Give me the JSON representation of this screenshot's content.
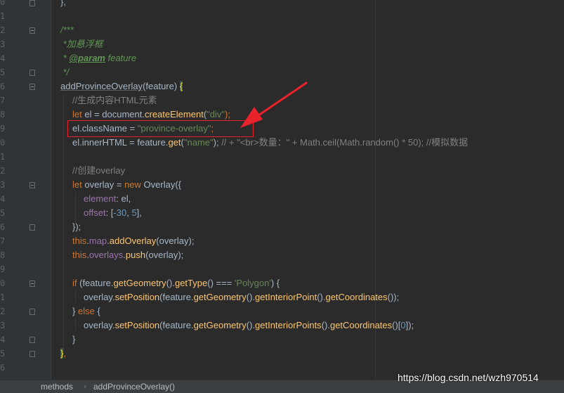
{
  "gutter": {
    "line_numbers": [
      "0",
      "1",
      "2",
      "3",
      "4",
      "5",
      "6",
      "7",
      "8",
      "9",
      "0",
      "1",
      "2",
      "3",
      "4",
      "5",
      "6",
      "7",
      "8",
      "9",
      "0",
      "1",
      "2",
      "3",
      "4",
      "5",
      "6"
    ]
  },
  "code": {
    "l0": "},",
    "l2": "/***",
    "l3": " *加悬浮框",
    "l4_star": " * ",
    "l4_tag": "@param",
    "l4_rest": " feature",
    "l5": " */",
    "l6_name": "addProvinceOverlay",
    "l6_args": "(feature) ",
    "l6_brace": "{",
    "l7": "//生成内容HTML元素",
    "l8_let": "let",
    "l8_a": " el = document.",
    "l8_fn": "createElement",
    "l8_b": "(",
    "l8_str": "\"div\"",
    "l8_c": ");",
    "l9_a": "el.className = ",
    "l9_str": "\"province-overlay\"",
    "l9_c": ";",
    "l10_a": "el.innerHTML = feature.",
    "l10_fn": "get",
    "l10_b": "(",
    "l10_str": "\"name\"",
    "l10_c": "); ",
    "l10_com": "// + \"<br>数量：\" + Math.ceil(Math.random() * 50); //模拟数据",
    "l12": "//创建overlay",
    "l13_let": "let",
    "l13_a": " overlay = ",
    "l13_new": "new",
    "l13_b": " Overlay({",
    "l14_prop": "element",
    "l14_a": ": el,",
    "l15_prop": "offset",
    "l15_a": ": [",
    "l15_n1": "-30",
    "l15_sep": ", ",
    "l15_n2": "5",
    "l15_b": "],",
    "l16": "});",
    "l17_this": "this",
    "l17_dot": ".",
    "l17_prop": "map",
    "l17_dot2": ".",
    "l17_fn": "addOverlay",
    "l17_b": "(overlay);",
    "l18_this": "this",
    "l18_dot": ".",
    "l18_prop": "overlays",
    "l18_dot2": ".",
    "l18_fn": "push",
    "l18_b": "(overlay);",
    "l20_if": "if",
    "l20_a": " (feature.",
    "l20_fn1": "getGeometry",
    "l20_b": "().",
    "l20_fn2": "getType",
    "l20_c": "() === ",
    "l20_str": "'Polygon'",
    "l20_d": ") {",
    "l21_a": "overlay.",
    "l21_fn1": "setPosition",
    "l21_b": "(feature.",
    "l21_fn2": "getGeometry",
    "l21_c": "().",
    "l21_fn3": "getInteriorPoint",
    "l21_d": "().",
    "l21_fn4": "getCoordinates",
    "l21_e": "());",
    "l22_a": "} ",
    "l22_else": "else",
    "l22_b": " {",
    "l23_a": "overlay.",
    "l23_fn1": "setPosition",
    "l23_b": "(feature.",
    "l23_fn2": "getGeometry",
    "l23_c": "().",
    "l23_fn3": "getInteriorPoints",
    "l23_d": "().",
    "l23_fn4": "getCoordinates",
    "l23_e": "()[",
    "l23_n": "0",
    "l23_f": "]);",
    "l24": "}",
    "l25_brace": "}",
    "l25_comma": ","
  },
  "statusbar": {
    "crumb1": "methods",
    "separator": "›",
    "crumb2": "addProvinceOverlay()"
  },
  "watermark": "https://blog.csdn.net/wzh970514",
  "colors": {
    "background": "#2b2b2b",
    "keyword": "#cc7832",
    "function": "#ffc66d",
    "string": "#6a8759",
    "number": "#6897bb",
    "property": "#9876aa",
    "comment": "#808080",
    "annotation_box": "#e8232b"
  }
}
